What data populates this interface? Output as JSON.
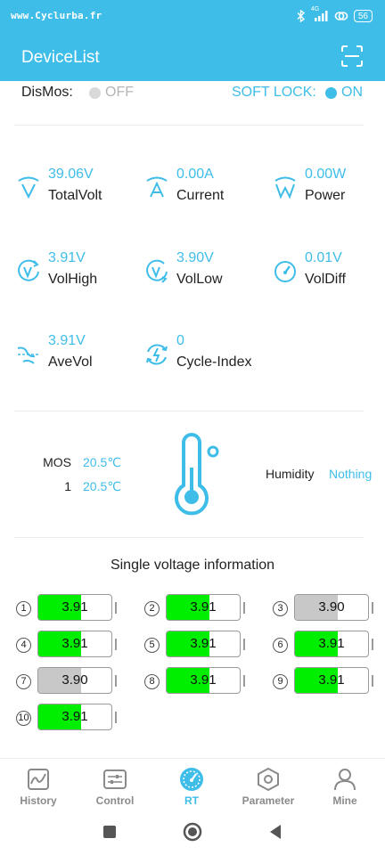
{
  "status_bar": {
    "left_text": "www.Cyclurba.fr",
    "network": "4G",
    "battery": "56"
  },
  "app_bar": {
    "title": "DeviceList",
    "scan_icon": "scan-icon"
  },
  "toggles": {
    "dismos_label": "DisMos:",
    "dismos_state": "OFF",
    "softlock_label": "SOFT LOCK:",
    "softlock_state": "ON"
  },
  "metrics": [
    {
      "value": "39.06V",
      "label": "TotalVolt",
      "icon": "total-volt-icon"
    },
    {
      "value": "0.00A",
      "label": "Current",
      "icon": "current-icon"
    },
    {
      "value": "0.00W",
      "label": "Power",
      "icon": "power-icon"
    },
    {
      "value": "3.91V",
      "label": "VolHigh",
      "icon": "vol-high-icon"
    },
    {
      "value": "3.90V",
      "label": "VolLow",
      "icon": "vol-low-icon"
    },
    {
      "value": "0.01V",
      "label": "VolDiff",
      "icon": "vol-diff-icon"
    },
    {
      "value": "3.91V",
      "label": "AveVol",
      "icon": "ave-vol-icon"
    },
    {
      "value": "0",
      "label": "Cycle-Index",
      "icon": "cycle-index-icon"
    }
  ],
  "temperature": {
    "rows": [
      {
        "label": "MOS",
        "value": "20.5℃"
      },
      {
        "label": "1",
        "value": "20.5℃"
      }
    ],
    "humidity_label": "Humidity",
    "humidity_value": "Nothing"
  },
  "single_voltage": {
    "title": "Single voltage information",
    "cells": [
      {
        "index": "1",
        "value": "3.91",
        "state": "high"
      },
      {
        "index": "2",
        "value": "3.91",
        "state": "high"
      },
      {
        "index": "3",
        "value": "3.90",
        "state": "low"
      },
      {
        "index": "4",
        "value": "3.91",
        "state": "high"
      },
      {
        "index": "5",
        "value": "3.91",
        "state": "high"
      },
      {
        "index": "6",
        "value": "3.91",
        "state": "high"
      },
      {
        "index": "7",
        "value": "3.90",
        "state": "low"
      },
      {
        "index": "8",
        "value": "3.91",
        "state": "high"
      },
      {
        "index": "9",
        "value": "3.91",
        "state": "high"
      },
      {
        "index": "10",
        "value": "3.91",
        "state": "high"
      }
    ]
  },
  "bottom_nav": [
    {
      "label": "History",
      "icon": "history-icon",
      "active": false
    },
    {
      "label": "Control",
      "icon": "control-icon",
      "active": false
    },
    {
      "label": "RT",
      "icon": "rt-gauge-icon",
      "active": true
    },
    {
      "label": "Parameter",
      "icon": "parameter-icon",
      "active": false
    },
    {
      "label": "Mine",
      "icon": "mine-icon",
      "active": false
    }
  ],
  "colors": {
    "accent": "#3fbde9",
    "cell_high": "#00ee00",
    "cell_low": "#c8c8c8",
    "inactive_nav": "#8a8a8a"
  }
}
